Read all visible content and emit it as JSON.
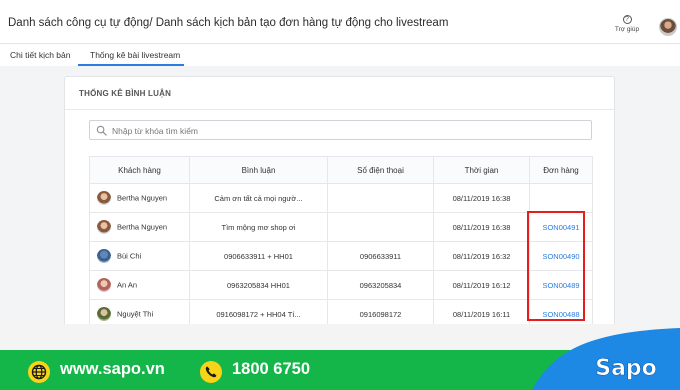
{
  "header": {
    "breadcrumb": "Danh sách công cụ tự động/ Danh sách kịch bản tạo đơn hàng tự động cho livestream",
    "help_label": "Trợ giúp"
  },
  "tabs": [
    {
      "label": "Chi tiết kịch bản"
    },
    {
      "label": "Thống kê bài livestream",
      "active": true
    }
  ],
  "card": {
    "title": "THỐNG KÊ BÌNH LUẬN"
  },
  "search": {
    "placeholder": "Nhập từ khóa tìm kiếm"
  },
  "table": {
    "headers": [
      "Khách hàng",
      "Bình luận",
      "Số điện thoại",
      "Thời gian",
      "Đơn hàng"
    ],
    "rows": [
      {
        "customer": "Bertha Nguyen",
        "comment": "Cảm ơn tất cả mọi ngườ...",
        "phone": "",
        "time": "08/11/2019 16:38",
        "order": ""
      },
      {
        "customer": "Bertha Nguyen",
        "comment": "Tìm mộng mơ shop ơi",
        "phone": "",
        "time": "08/11/2019 16:38",
        "order": "SON00491"
      },
      {
        "customer": "Bùi Chi",
        "comment": "0906633911 + HH01",
        "phone": "0906633911",
        "time": "08/11/2019 16:32",
        "order": "SON00490"
      },
      {
        "customer": "An An",
        "comment": "0963205834 HH01",
        "phone": "0963205834",
        "time": "08/11/2019 16:12",
        "order": "SON00489"
      },
      {
        "customer": "Nguyệt Thi",
        "comment": "0916098172 + HH04 Tí...",
        "phone": "0916098172",
        "time": "08/11/2019 16:11",
        "order": "SON00488"
      }
    ]
  },
  "footer": {
    "website": "www.sapo.vn",
    "hotline": "1800 6750",
    "logo_text": "Sapo"
  },
  "colors": {
    "accent_blue": "#2a7de1",
    "highlight_red": "#e51d1d",
    "brand_green": "#14b64a",
    "brand_blue": "#1e88e5",
    "icon_yellow": "#f7d417"
  }
}
